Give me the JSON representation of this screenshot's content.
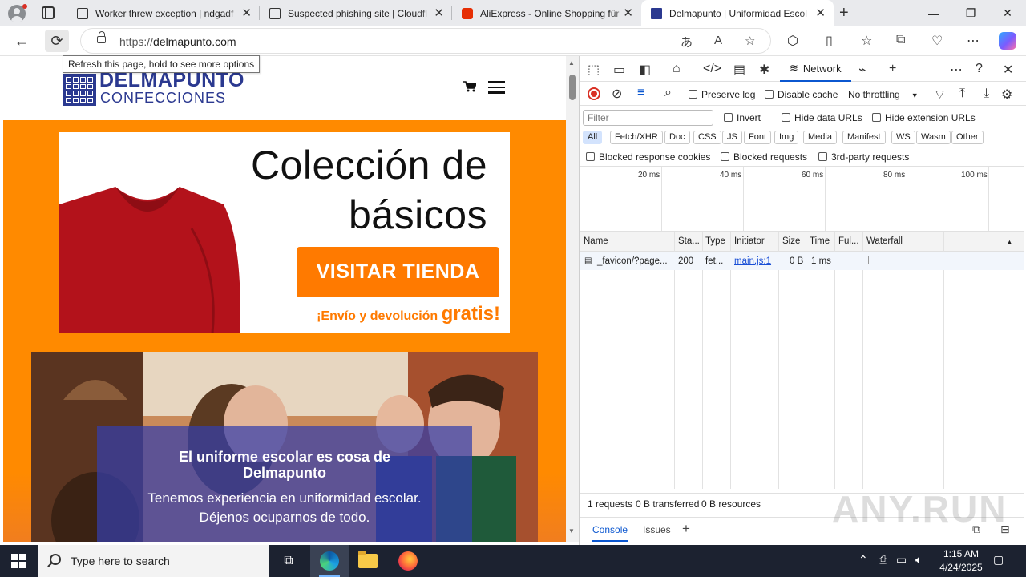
{
  "browser": {
    "tabs": [
      {
        "title": "Worker threw exception | ndgadf",
        "favicon": "document-icon",
        "active": false
      },
      {
        "title": "Suspected phishing site | Cloudfl",
        "favicon": "document-icon",
        "active": false
      },
      {
        "title": "AliExpress - Online Shopping für",
        "favicon": "aliexpress-icon",
        "active": false
      },
      {
        "title": "Delmapunto | Uniformidad Escol",
        "favicon": "delmapunto-icon",
        "active": true
      }
    ],
    "address": {
      "scheme": "https://",
      "host": "delmapunto.com"
    },
    "tooltip": "Refresh this page, hold to see more options"
  },
  "site": {
    "logo_name": "DELMAPUNTO",
    "logo_sub": "CONFECCIONES",
    "banner": {
      "title_line1": "Colección de",
      "title_line2": "básicos",
      "button": "VISITAR TIENDA",
      "shipping_prefix": "¡Envío y devolución ",
      "shipping_emph": "gratis!"
    },
    "hero": {
      "heading_line1": "El uniforme escolar es cosa de",
      "heading_line2": "Delmapunto",
      "text_line1": "Tenemos experiencia en uniformidad escolar.",
      "text_line2": "Déjenos ocuparnos de todo."
    }
  },
  "devtools": {
    "active_panel": "Network",
    "toolbar": {
      "preserve_log": "Preserve log",
      "disable_cache": "Disable cache",
      "throttling": "No throttling"
    },
    "filter": {
      "placeholder": "Filter",
      "invert": "Invert",
      "hide_data_urls": "Hide data URLs",
      "hide_extension_urls": "Hide extension URLs"
    },
    "types": [
      "All",
      "Fetch/XHR",
      "Doc",
      "CSS",
      "JS",
      "Font",
      "Img",
      "Media",
      "Manifest",
      "WS",
      "Wasm",
      "Other"
    ],
    "options": {
      "blocked_cookies": "Blocked response cookies",
      "blocked_requests": "Blocked requests",
      "third_party": "3rd-party requests"
    },
    "timeline_labels": [
      "20 ms",
      "40 ms",
      "60 ms",
      "80 ms",
      "100 ms"
    ],
    "columns": [
      "Name",
      "Sta...",
      "Type",
      "Initiator",
      "Size",
      "Time",
      "Ful...",
      "Waterfall"
    ],
    "rows": [
      {
        "name": "_favicon/?page...",
        "status": "200",
        "type": "fet...",
        "initiator": "main.js:1",
        "size": "0 B",
        "time": "1 ms",
        "full": ""
      }
    ],
    "summary": {
      "requests": "1 requests",
      "transferred": "0 B transferred",
      "resources": "0 B resources"
    },
    "drawer_tabs": [
      "Console",
      "Issues"
    ]
  },
  "watermark": "ANY.RUN",
  "taskbar": {
    "search_placeholder": "Type here to search",
    "time": "1:15 AM",
    "date": "4/24/2025"
  },
  "colors": {
    "brand_blue": "#2b3990",
    "orange": "#ff8a00",
    "devtools_blue": "#0b57d0"
  }
}
